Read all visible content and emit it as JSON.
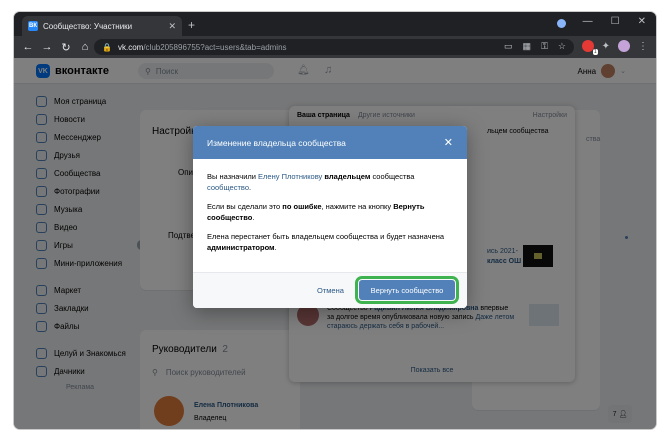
{
  "browser": {
    "tab_title": "Сообщество: Участники",
    "tab_favicon": "ВК",
    "tab_close": "✕",
    "new_tab": "+",
    "url_host": "vk.com",
    "url_path": "/club205896755?act=users&tab=admins",
    "ext_badge": "1"
  },
  "vk": {
    "logo_text": "вконтакте",
    "logo_mark": "VK",
    "search_placeholder": "Поиск",
    "user_name": "Анна"
  },
  "sidebar": {
    "items": [
      {
        "label": "Моя страница",
        "icon": "user-circle-icon"
      },
      {
        "label": "Новости",
        "icon": "news-icon"
      },
      {
        "label": "Мессенджер",
        "icon": "chat-icon"
      },
      {
        "label": "Друзья",
        "icon": "friends-icon"
      },
      {
        "label": "Сообщества",
        "icon": "groups-icon"
      },
      {
        "label": "Фотографии",
        "icon": "photo-icon"
      },
      {
        "label": "Музыка",
        "icon": "music-icon"
      },
      {
        "label": "Видео",
        "icon": "video-icon"
      },
      {
        "label": "Игры",
        "icon": "games-icon",
        "badge": "2"
      },
      {
        "label": "Мини-приложения",
        "icon": "apps-icon"
      },
      {
        "label": "Маркет",
        "icon": "market-icon"
      },
      {
        "label": "Закладки",
        "icon": "bookmark-icon"
      },
      {
        "label": "Файлы",
        "icon": "file-icon"
      },
      {
        "label": "Целуй и Знакомься",
        "icon": "app-icon"
      },
      {
        "label": "Дачники",
        "icon": "app-icon"
      }
    ],
    "footer": "Реклама"
  },
  "settings_card": {
    "title": "Настройки",
    "frag1": "Опи",
    "frag2": "Подтве"
  },
  "leaders_card": {
    "title": "Руководители",
    "count": "2",
    "search_placeholder": "Поиск руководителей",
    "leader_name": "Елена Плотникова",
    "leader_role": "Владелец"
  },
  "right_card": {
    "frag": "ства"
  },
  "notifications": {
    "tab_mine": "Ваша страница",
    "tab_other": "Другие источники",
    "settings": "Настройки",
    "frag1": "льцем сообщества",
    "frag2": "ись 2021-",
    "frag3": "класс ОШ 1-",
    "item_prefix": "Сообщество",
    "item_author": "Радивил Лилия Владимировна",
    "item_text": "впервые за долгое время опубликовала новую запись",
    "item_link": "Даже летом стараюсь держать себя в рабочей...",
    "show_all": "Показать все"
  },
  "counter": "7",
  "modal": {
    "title": "Изменение владельца сообщества",
    "close": "✕",
    "p1_a": "Вы назначили ",
    "p1_link": "Елену Плотникову",
    "p1_b": " владельцем",
    "p1_c": " сообщества ",
    "p1_link2": "сообщество",
    "p1_end": ".",
    "p2_a": "Если вы сделали это ",
    "p2_b": "по ошибке",
    "p2_c": ", нажмите на кнопку ",
    "p2_d": "Вернуть сообщество",
    "p2_end": ".",
    "p3_a": "Елена перестанет быть владельцем сообщества и будет назначена ",
    "p3_b": "администратором",
    "p3_end": ".",
    "cancel": "Отмена",
    "confirm": "Вернуть сообщество"
  },
  "colors": {
    "vk_blue": "#5181b8",
    "highlight": "#3fb34f"
  }
}
